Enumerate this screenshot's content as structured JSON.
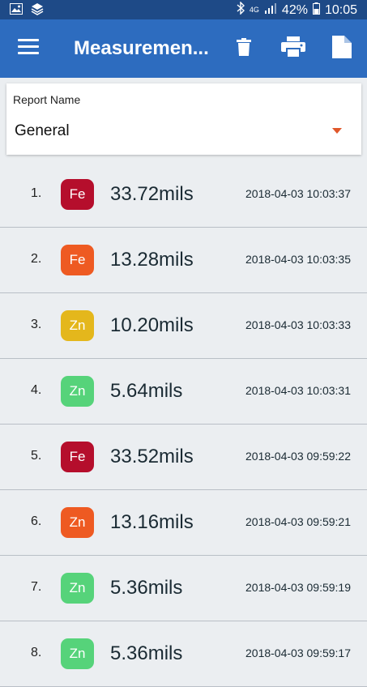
{
  "status_bar": {
    "network": "4G",
    "battery": "42%",
    "time": "10:05"
  },
  "app_bar": {
    "title": "Measuremen..."
  },
  "report": {
    "label": "Report Name",
    "value": "General"
  },
  "colors": {
    "primary": "#2d6cbf",
    "status_bar": "#1e4a87",
    "dropdown_caret": "#e0572a"
  },
  "measurements": [
    {
      "index": "1.",
      "metal": "Fe",
      "color": "#b50e2c",
      "value": "33.72mils",
      "time": "2018-04-03 10:03:37"
    },
    {
      "index": "2.",
      "metal": "Fe",
      "color": "#ee5a22",
      "value": "13.28mils",
      "time": "2018-04-03 10:03:35"
    },
    {
      "index": "3.",
      "metal": "Zn",
      "color": "#e4b71c",
      "value": "10.20mils",
      "time": "2018-04-03 10:03:33"
    },
    {
      "index": "4.",
      "metal": "Zn",
      "color": "#56d37a",
      "value": "5.64mils",
      "time": "2018-04-03 10:03:31"
    },
    {
      "index": "5.",
      "metal": "Fe",
      "color": "#b50e2c",
      "value": "33.52mils",
      "time": "2018-04-03 09:59:22"
    },
    {
      "index": "6.",
      "metal": "Zn",
      "color": "#ee5a22",
      "value": "13.16mils",
      "time": "2018-04-03 09:59:21"
    },
    {
      "index": "7.",
      "metal": "Zn",
      "color": "#56d37a",
      "value": "5.36mils",
      "time": "2018-04-03 09:59:19"
    },
    {
      "index": "8.",
      "metal": "Zn",
      "color": "#56d37a",
      "value": "5.36mils",
      "time": "2018-04-03 09:59:17"
    }
  ]
}
